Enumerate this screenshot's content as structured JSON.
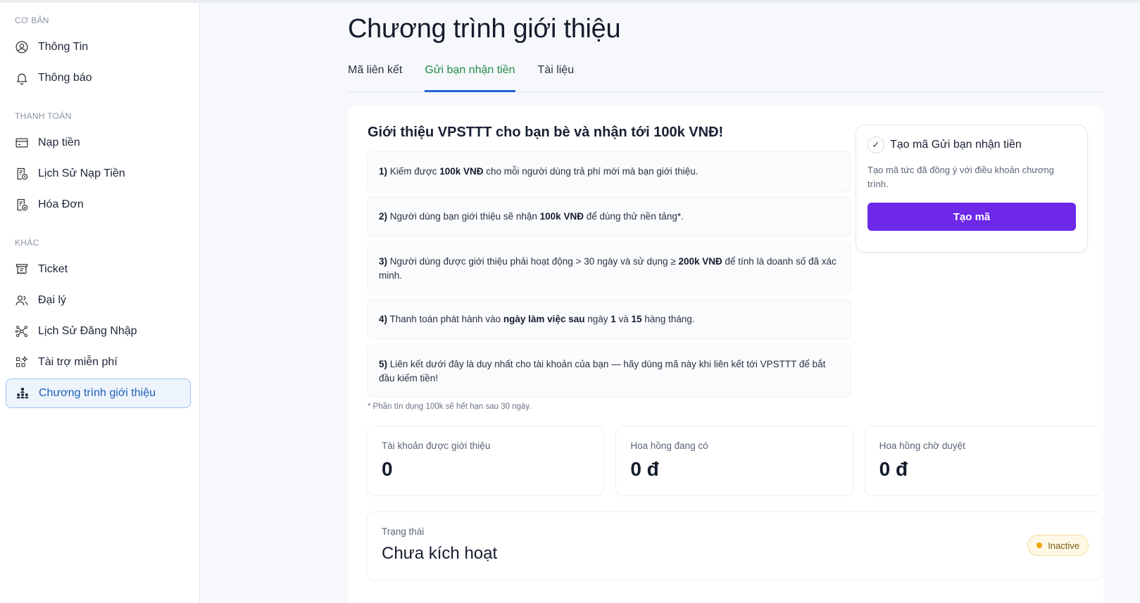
{
  "sidebar": {
    "sections": {
      "basic": "CƠ BẢN",
      "payment": "THANH TOÁN",
      "other": "KHÁC"
    },
    "items": [
      {
        "label": "Thông Tin",
        "icon": "user-circle-icon"
      },
      {
        "label": "Thông báo",
        "icon": "bell-icon"
      },
      {
        "label": "Nạp tiền",
        "icon": "credit-card-icon"
      },
      {
        "label": "Lịch Sử Nạp Tiền",
        "icon": "receipt-clock-icon"
      },
      {
        "label": "Hóa Đơn",
        "icon": "invoice-icon"
      },
      {
        "label": "Ticket",
        "icon": "ticket-icon"
      },
      {
        "label": "Đại lý",
        "icon": "users-icon"
      },
      {
        "label": "Lịch Sử Đăng Nhập",
        "icon": "network-icon"
      },
      {
        "label": "Tài trợ miễn phí",
        "icon": "sparkle-grid-icon"
      },
      {
        "label": "Chương trình giới thiệu",
        "icon": "org-chart-icon"
      }
    ],
    "active_index": 9
  },
  "page": {
    "title": "Chương trình giới thiệu"
  },
  "tabs": [
    {
      "label": "Mã liên kết"
    },
    {
      "label": "Gửi bạn nhận tiền"
    },
    {
      "label": "Tài liệu"
    }
  ],
  "active_tab": 1,
  "panel": {
    "title": "Giới thiệu VPSTTT cho bạn bè và nhận tới 100k VNĐ!",
    "rules": [
      {
        "num": "1)",
        "pre": " Kiếm được ",
        "bold1": "100k VNĐ",
        "mid": " cho mỗi người dùng trả phí mới mà bạn giới thiệu.",
        "bold2": "",
        "post": "",
        "bold3": "",
        "end": ""
      },
      {
        "num": "2)",
        "pre": " Người dùng bạn giới thiệu sẽ nhận ",
        "bold1": "100k VNĐ",
        "mid": " để dùng thử nền tảng*.",
        "bold2": "",
        "post": "",
        "bold3": "",
        "end": ""
      },
      {
        "num": "3)",
        "pre": " Người dùng được giới thiệu phải hoạt động > 30 ngày và sử dụng ≥ ",
        "bold1": "200k VNĐ",
        "mid": " để tính là doanh số đã xác minh.",
        "bold2": "",
        "post": "",
        "bold3": "",
        "end": ""
      },
      {
        "num": "4)",
        "pre": " Thanh toán phát hành vào ",
        "bold1": "ngày làm việc sau",
        "mid": " ngày ",
        "bold2": "1",
        "post": " và ",
        "bold3": "15",
        "end": " hàng tháng."
      },
      {
        "num": "5)",
        "pre": " Liên kết dưới đây là duy nhất cho tài khoản của bạn — hãy dùng mã này khi liên kết tới VPSTTT để bắt đầu kiếm tiền!",
        "bold1": "",
        "mid": "",
        "bold2": "",
        "post": "",
        "bold3": "",
        "end": ""
      }
    ],
    "footnote": "* Phần tín dụng 100k sẽ hết hạn sau 30 ngày."
  },
  "create_card": {
    "check_glyph": "✓",
    "title": "Tạo mã Gửi bạn nhận tiền",
    "description": "Tạo mã tức đã đồng ý với điều khoản chương trình.",
    "button_label": "Tạo mã",
    "button_color": "#6d28e8"
  },
  "stats": [
    {
      "label": "Tài khoản được giới thiệu",
      "value": "0"
    },
    {
      "label": "Hoa hồng đang có",
      "value": "0 đ"
    },
    {
      "label": "Hoa hồng chờ duyệt",
      "value": "0 đ"
    }
  ],
  "status": {
    "label": "Trạng thái",
    "value": "Chưa kích hoạt",
    "badge": "Inactive",
    "badge_dot_color": "#f0a500"
  },
  "colors": {
    "active_tab_text": "#218a4a",
    "active_tab_underline": "#2563d6",
    "active_nav_bg": "#eef4fc",
    "active_nav_text": "#1e5fb8"
  }
}
